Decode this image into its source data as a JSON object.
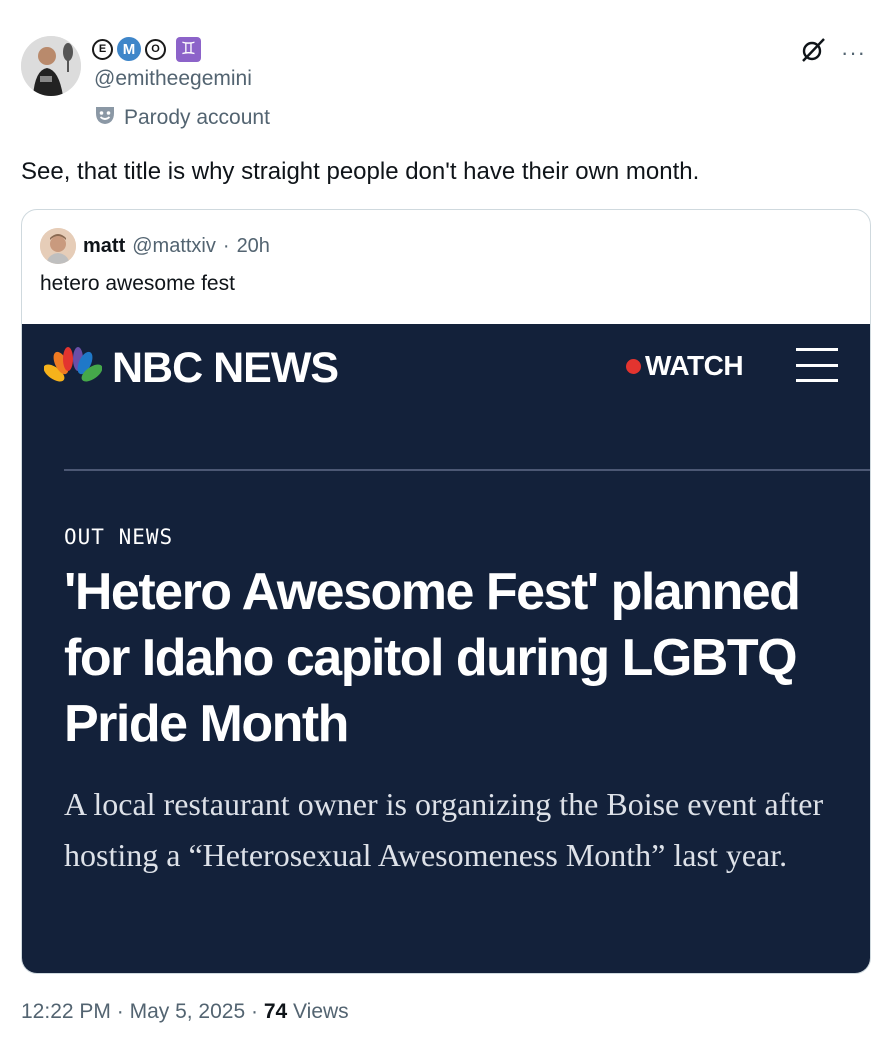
{
  "author": {
    "handle": "@emitheegemini",
    "emoji_c": "E",
    "emoji_m": "M",
    "emoji_o": "O",
    "emoji_gemini": "♊",
    "parody_label": "Parody account"
  },
  "tweet": {
    "text": "See, that title is why straight people don't have their own month."
  },
  "quoted": {
    "name": "matt",
    "handle": "@mattxiv",
    "separator": "·",
    "age": "20h",
    "text": "hetero awesome fest"
  },
  "article": {
    "brand": "NBC NEWS",
    "watch_label": "WATCH",
    "section": "OUT NEWS",
    "headline": "'Hetero Awesome Fest' planned for Idaho capitol during LGBTQ Pride Month",
    "dek": "A local restaurant owner is organizing the Boise event after hosting a “Heterosexual Awesomeness Month” last year."
  },
  "footer": {
    "time": "12:22 PM",
    "sep1": "·",
    "date": "May 5, 2025",
    "sep2": "·",
    "views_count": "74",
    "views_label": "Views"
  },
  "icons": {
    "avatar": "avatar",
    "grok": "grok-icon",
    "more": "more-icon",
    "parody": "parody-mask-icon",
    "nbc_peacock": "nbc-peacock-icon",
    "menu": "hamburger-menu-icon"
  },
  "colors": {
    "nbc_background": "#13213a",
    "watch_dot": "#e3342f",
    "secondary_text": "#536471"
  }
}
